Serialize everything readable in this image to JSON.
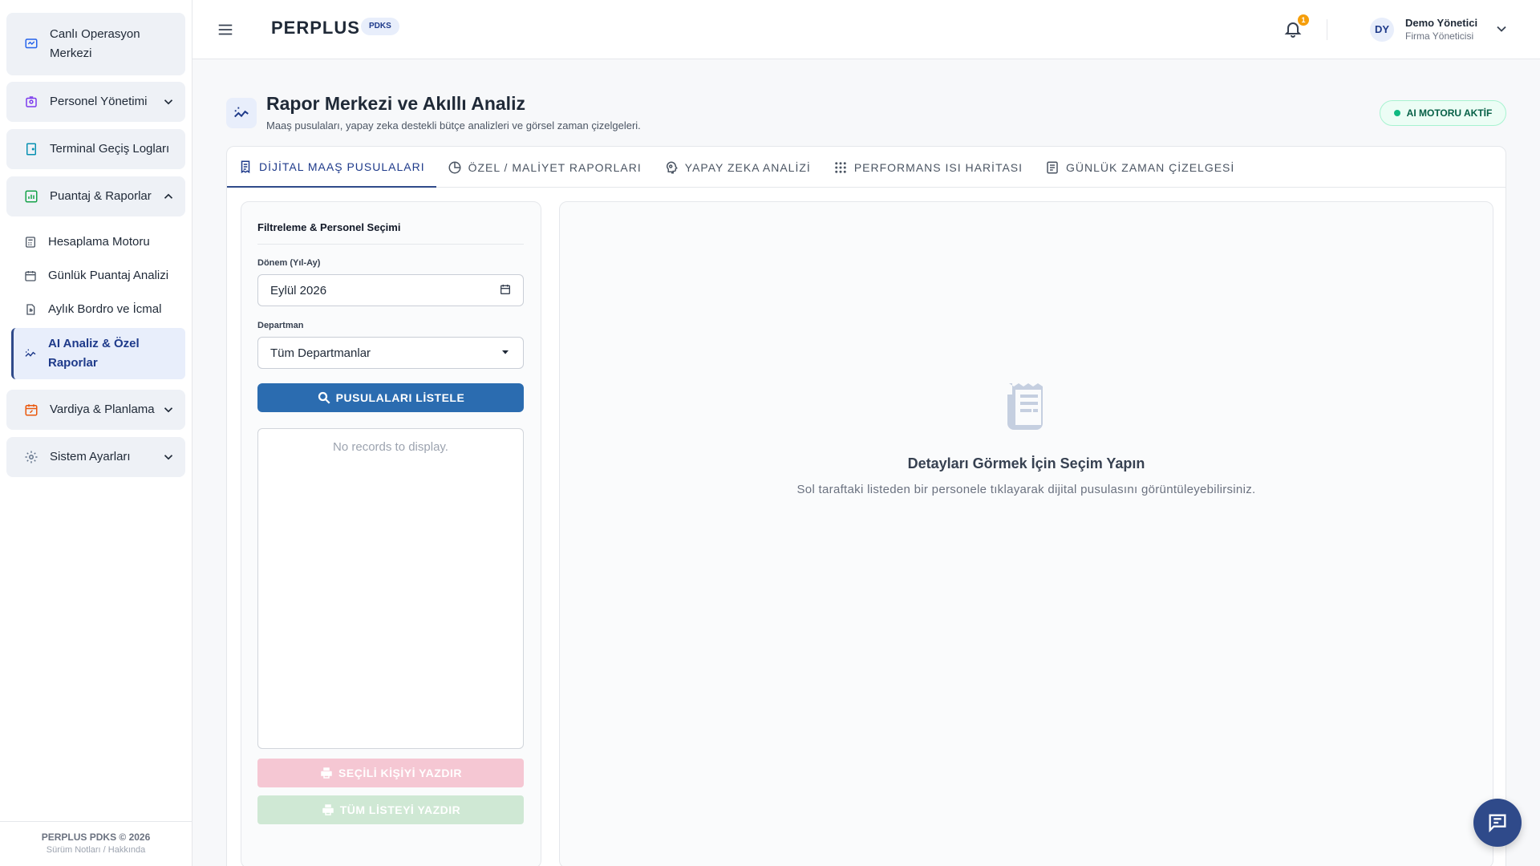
{
  "sidebar": {
    "groups": {
      "live": "Canlı Operasyon Merkezi",
      "personnel": "Personel Yönetimi",
      "terminal": "Terminal Geçiş Logları",
      "timesheet": "Puantaj & Raporlar",
      "shift": "Vardiya & Planlama",
      "settings": "Sistem Ayarları"
    },
    "sub_items": {
      "engine": "Hesaplama Motoru",
      "daily": "Günlük Puantaj Analizi",
      "monthly": "Aylık Bordro ve İcmal",
      "ai": "AI Analiz & Özel Raporlar"
    },
    "footer": {
      "copyright": "PERPLUS PDKS © 2026",
      "links": "Sürüm Notları / Hakkında"
    }
  },
  "header": {
    "brand": "PERPLUS",
    "brand_badge": "PDKS",
    "notification_count": "1",
    "user_initials": "DY",
    "user_name": "Demo Yönetici",
    "user_role": "Firma Yöneticisi"
  },
  "page": {
    "title": "Rapor Merkezi ve Akıllı Analiz",
    "subtitle": "Maaş pusulaları, yapay zeka destekli bütçe analizleri ve görsel zaman çizelgeleri.",
    "status_badge": "AI MOTORU AKTİF"
  },
  "tabs": {
    "payslips": "DİJİTAL MAAŞ PUSULALARI",
    "cost": "ÖZEL / MALİYET RAPORLARI",
    "ai": "YAPAY ZEKA ANALİZİ",
    "heatmap": "PERFORMANS ISI HARİTASI",
    "timeline": "GÜNLÜK ZAMAN ÇİZELGESİ"
  },
  "filter": {
    "title": "Filtreleme & Personel Seçimi",
    "period_label": "Dönem (Yıl-Ay)",
    "period_value": "Eylül 2026",
    "dept_label": "Departman",
    "dept_value": "Tüm Departmanlar",
    "list_button": "PUSULALARI LİSTELE",
    "empty_records": "No records to display.",
    "print_selected": "SEÇİLİ KİŞİYİ YAZDIR",
    "print_all": "TÜM LİSTEYİ YAZDIR"
  },
  "details": {
    "empty_title": "Detayları Görmek İçin Seçim Yapın",
    "empty_subtitle": "Sol taraftaki listeden bir personele tıklayarak dijital pusulasını görüntüleyebilirsiniz."
  },
  "icons": {
    "hamburger": "menu-icon",
    "bell": "bell-icon",
    "chat": "chat-icon"
  },
  "colors": {
    "primary": "#2f4a8a",
    "button_blue": "#2b6cb0",
    "success": "#10b981",
    "warning": "#f59e0b"
  }
}
